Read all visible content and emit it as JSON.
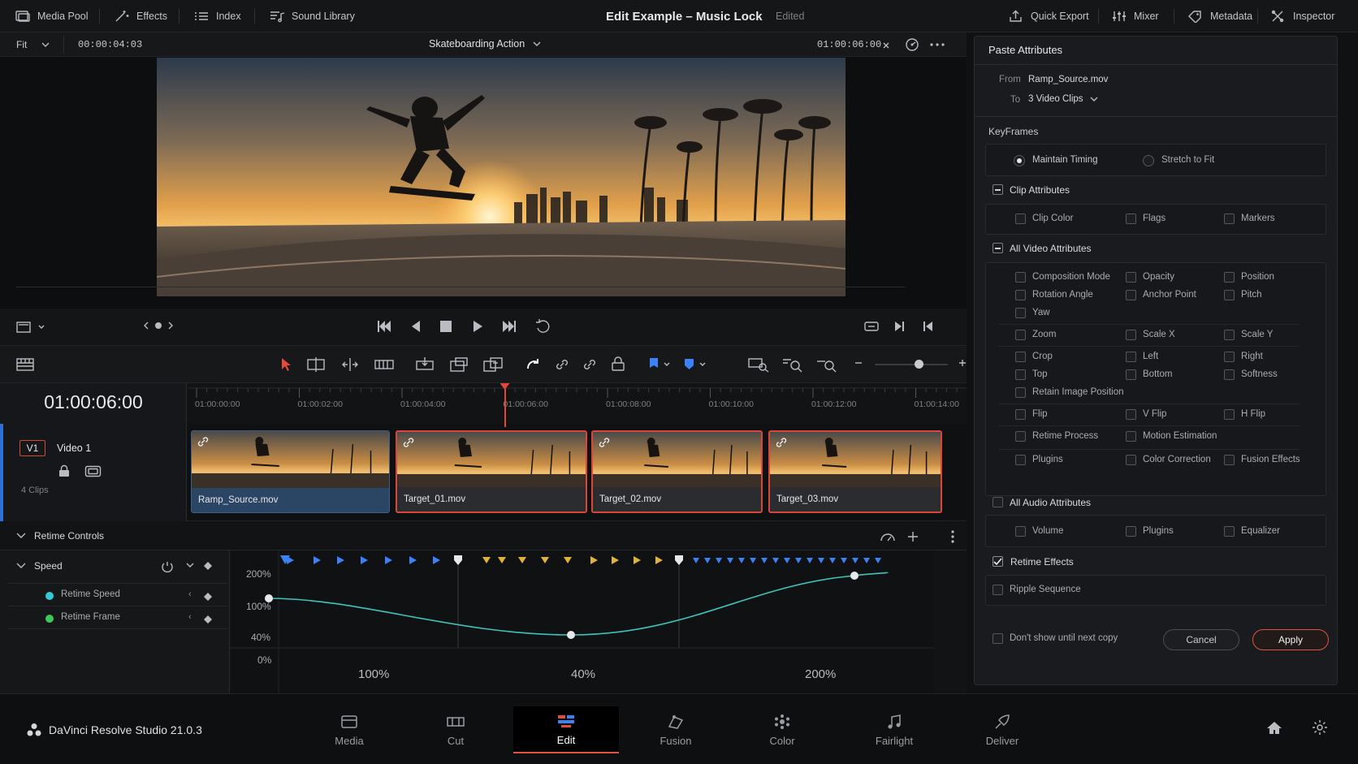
{
  "topbar": {
    "media_pool": "Media Pool",
    "effects": "Effects",
    "index": "Index",
    "sound_library": "Sound Library",
    "project_title": "Edit Example – Music Lock",
    "project_status": "Edited",
    "quick_export": "Quick Export",
    "mixer": "Mixer",
    "metadata": "Metadata",
    "inspector": "Inspector"
  },
  "viewer": {
    "zoom": "Fit",
    "source_timecode": "00:00:04:03",
    "timeline_name": "Skateboarding Action",
    "record_timecode": "01:00:06:00"
  },
  "timeline": {
    "current_timecode": "01:00:06:00",
    "ruler_ticks": [
      "01:00:00:00",
      "01:00:02:00",
      "01:00:04:00",
      "01:00:06:00",
      "01:00:08:00",
      "01:00:10:00",
      "01:00:12:00",
      "01:00:14:00"
    ],
    "playhead_fraction": 0.375,
    "track": {
      "id": "V1",
      "name": "Video 1",
      "clip_count": "4 Clips"
    },
    "clips": [
      {
        "name": "Ramp_Source.mov",
        "selected_source": true
      },
      {
        "name": "Target_01.mov",
        "selected_source": false
      },
      {
        "name": "Target_02.mov",
        "selected_source": false
      },
      {
        "name": "Target_03.mov",
        "selected_source": false
      }
    ]
  },
  "retime": {
    "title": "Retime Controls",
    "speed_label": "Speed",
    "items": [
      {
        "label": "Retime Speed",
        "color": "#35c8d8"
      },
      {
        "label": "Retime Frame",
        "color": "#3ac95a"
      }
    ],
    "y_labels": [
      "200%",
      "100%",
      "40%",
      "0%"
    ],
    "segment_labels": [
      "100%",
      "40%",
      "200%"
    ]
  },
  "paste_attributes": {
    "title": "Paste Attributes",
    "from_label": "From",
    "from_value": "Ramp_Source.mov",
    "to_label": "To",
    "to_value": "3 Video Clips",
    "keyframes_label": "KeyFrames",
    "maintain_timing": "Maintain Timing",
    "stretch_to_fit": "Stretch to Fit",
    "clip_attributes": {
      "title": "Clip Attributes",
      "items": [
        "Clip Color",
        "Flags",
        "Markers"
      ]
    },
    "video_attributes": {
      "title": "All Video Attributes",
      "items": [
        "Composition Mode",
        "Opacity",
        "Position",
        "Rotation Angle",
        "Anchor Point",
        "Pitch",
        "Yaw",
        "Zoom",
        "Scale X",
        "Scale Y",
        "Crop",
        "Left",
        "Right",
        "Top",
        "Bottom",
        "Softness",
        "Retain Image Position",
        "Flip",
        "V Flip",
        "H Flip",
        "Retime Process",
        "Motion Estimation",
        "Plugins",
        "Color Correction",
        "Fusion Effects"
      ]
    },
    "audio_attributes": {
      "title": "All Audio Attributes",
      "items": [
        "Volume",
        "Plugins",
        "Equalizer"
      ]
    },
    "retime_effects": "Retime Effects",
    "ripple_sequence": "Ripple Sequence",
    "dont_show": "Don't show until next copy",
    "cancel": "Cancel",
    "apply": "Apply"
  },
  "bottombar": {
    "app_name": "DaVinci Resolve Studio 21.0.3",
    "pages": [
      "Media",
      "Cut",
      "Edit",
      "Fusion",
      "Color",
      "Fairlight",
      "Deliver"
    ],
    "active_page": "Edit"
  }
}
